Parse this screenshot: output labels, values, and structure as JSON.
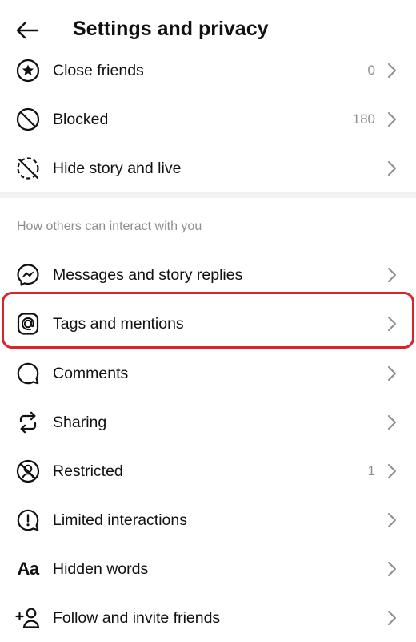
{
  "header": {
    "title": "Settings and privacy",
    "back_icon": "arrow-left-icon"
  },
  "top_items": [
    {
      "label": "Close friends",
      "count": "0",
      "icon": "star-circle-icon"
    },
    {
      "label": "Blocked",
      "count": "180",
      "icon": "blocked-icon"
    },
    {
      "label": "Hide story and live",
      "count": "",
      "icon": "hide-story-icon"
    }
  ],
  "section": {
    "header": "How others can interact with you"
  },
  "interaction_items": [
    {
      "label": "Messages and story replies",
      "count": "",
      "icon": "messenger-icon"
    },
    {
      "label": "Tags and mentions",
      "count": "",
      "icon": "at-sign-icon"
    },
    {
      "label": "Comments",
      "count": "",
      "icon": "comment-bubble-icon"
    },
    {
      "label": "Sharing",
      "count": "",
      "icon": "share-arrows-icon"
    },
    {
      "label": "Restricted",
      "count": "1",
      "icon": "restricted-icon"
    },
    {
      "label": "Limited interactions",
      "count": "",
      "icon": "exclamation-bubble-icon"
    },
    {
      "label": "Hidden words",
      "count": "",
      "icon": "text-aa-icon",
      "glyph": "Aa"
    },
    {
      "label": "Follow and invite friends",
      "count": "",
      "icon": "add-person-icon"
    }
  ],
  "colors": {
    "highlight": "#d9242e",
    "secondary_text": "#8e8e8e",
    "divider": "#f2f2f2"
  }
}
